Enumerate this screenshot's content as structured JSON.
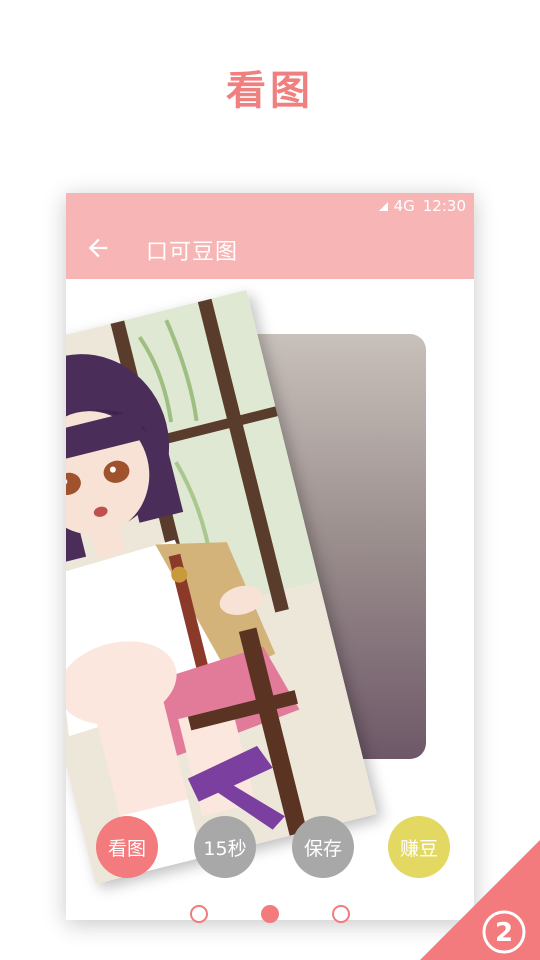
{
  "headline": "看图",
  "statusbar": {
    "network": "4G",
    "time": "12:30"
  },
  "appbar": {
    "title": "口可豆图"
  },
  "actions": [
    {
      "label": "看图",
      "color": "#f37a7d"
    },
    {
      "label": "15秒",
      "color": "#a8a8a8"
    },
    {
      "label": "保存",
      "color": "#a8a8a8"
    },
    {
      "label": "赚豆",
      "color": "#e3d862"
    }
  ],
  "pager": {
    "active_index": 1,
    "count": 3,
    "color": "#f37a7d"
  },
  "step_badge": "2",
  "colors": {
    "accent": "#f8b5b5",
    "headline": "#f08080"
  }
}
